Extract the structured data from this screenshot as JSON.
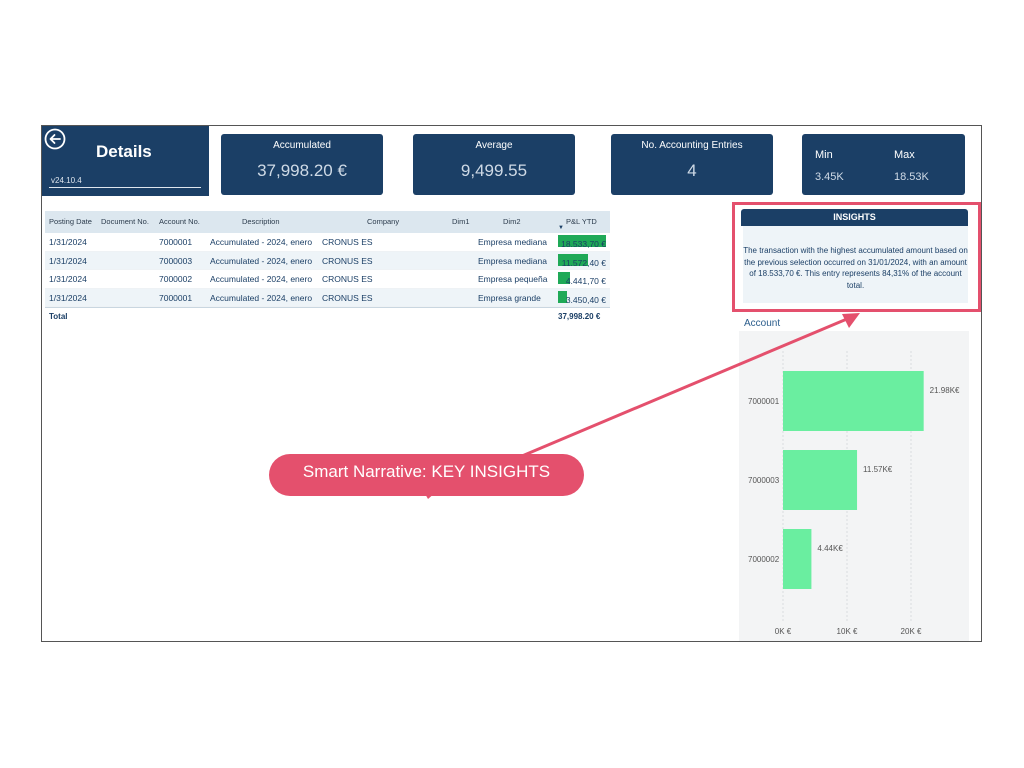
{
  "header": {
    "title": "Details",
    "version": "v24.10.4",
    "back_icon": "back-arrow-circle-icon"
  },
  "kpis": [
    {
      "label": "Accumulated",
      "value": "37,998.20 €"
    },
    {
      "label": "Average",
      "value": "9,499.55"
    },
    {
      "label": "No. Accounting Entries",
      "value": "4"
    }
  ],
  "minmax": {
    "min_label": "Min",
    "max_label": "Max",
    "min_value": "3.45K",
    "max_value": "18.53K"
  },
  "table": {
    "columns": [
      "Posting Date",
      "Document No.",
      "Account No.",
      "Description",
      "Company",
      "Dim1",
      "Dim2",
      "P&L YTD"
    ],
    "rows": [
      {
        "posting_date": "1/31/2024",
        "account": "7000001",
        "description": "Accumulated - 2024, enero",
        "company": "CRONUS ES",
        "dim2": "Empresa mediana",
        "pl_ytd": "18.533,70 €",
        "share": 1.0
      },
      {
        "posting_date": "1/31/2024",
        "account": "7000003",
        "description": "Accumulated - 2024, enero",
        "company": "CRONUS ES",
        "dim2": "Empresa mediana",
        "pl_ytd": "11.572,40 €",
        "share": 0.624
      },
      {
        "posting_date": "1/31/2024",
        "account": "7000002",
        "description": "Accumulated - 2024, enero",
        "company": "CRONUS ES",
        "dim2": "Empresa pequeña",
        "pl_ytd": "4.441,70 €",
        "share": 0.24
      },
      {
        "posting_date": "1/31/2024",
        "account": "7000001",
        "description": "Accumulated - 2024, enero",
        "company": "CRONUS ES",
        "dim2": "Empresa grande",
        "pl_ytd": "3.450,40 €",
        "share": 0.186
      }
    ],
    "total_label": "Total",
    "total_value": "37,998.20 €"
  },
  "insights": {
    "title": "INSIGHTS",
    "text": "The transaction with the highest accumulated amount based on the previous selection occurred on 31/01/2024, with an amount of 18.533,70 €. This entry represents 84,31% of the account total."
  },
  "callout": {
    "text": "Smart Narrative: KEY INSIGHTS"
  },
  "colors": {
    "navy": "#1b3f66",
    "bar_green": "#6aeea0",
    "table_bar": "#1fa957",
    "accent": "#e4506d"
  },
  "chart_data": {
    "type": "bar",
    "orientation": "horizontal",
    "title": "Account",
    "categories": [
      "7000001",
      "7000003",
      "7000002"
    ],
    "values": [
      21.98,
      11.57,
      4.44
    ],
    "data_labels": [
      "21.98K€",
      "11.57K€",
      "4.44K€"
    ],
    "x_ticks": [
      "0K €",
      "10K €",
      "20K €"
    ],
    "xlim": [
      0,
      25
    ]
  }
}
